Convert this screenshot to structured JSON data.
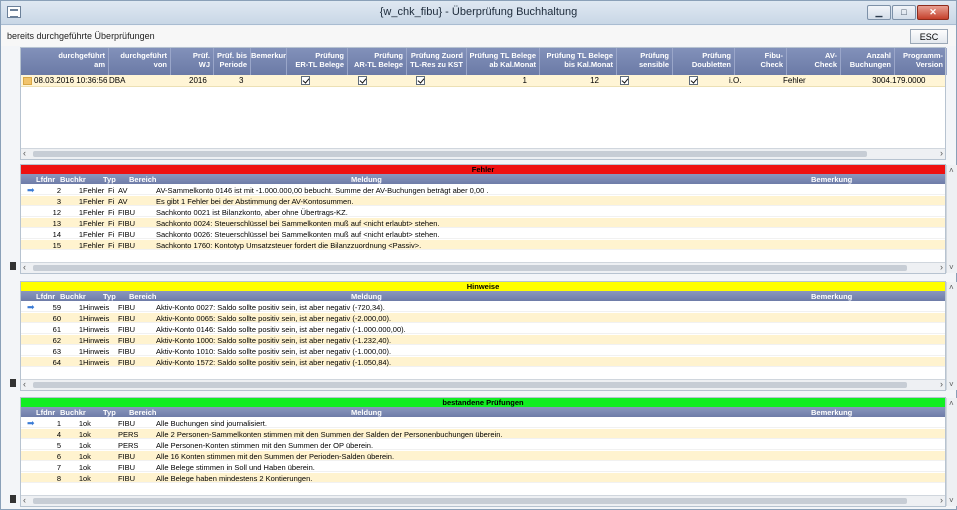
{
  "window": {
    "title": "{w_chk_fibu} - Überprüfung Buchhaltung"
  },
  "controls": {
    "minimize": "▁",
    "maximize": "□",
    "close": "✕",
    "esc": "ESC"
  },
  "subheader": {
    "label": "bereits durchgeführte Überprüfungen"
  },
  "top_grid": {
    "headers": [
      [
        "durchgeführt",
        "am"
      ],
      [
        "durchgeführt",
        "von"
      ],
      [
        "Prüf.",
        "WJ"
      ],
      [
        "Prüf. bis",
        "Periode"
      ],
      [
        "Bemerkung",
        ""
      ],
      [
        "Prüfung",
        "ER-TL Belege"
      ],
      [
        "Prüfung",
        "AR-TL Belege"
      ],
      [
        "Prüfung Zuord",
        "TL-Res zu KST"
      ],
      [
        "Prüfung TL Belege",
        "ab Kal.Monat"
      ],
      [
        "Prüfung TL Belege",
        "bis Kal.Monat"
      ],
      [
        "Prüfung",
        "sensible"
      ],
      [
        "Prüfung",
        "Doubletten"
      ],
      [
        "Fibu-",
        "Check"
      ],
      [
        "AV-",
        "Check"
      ],
      [
        "Anzahl",
        "Buchungen"
      ],
      [
        "Programm-",
        "Version"
      ]
    ],
    "row": {
      "datum": "08.03.2016 10:36:56",
      "von": "DBA",
      "wj": "2016",
      "periode": "3",
      "er_tl": true,
      "ar_tl": true,
      "zuord": true,
      "ab_monat": "1",
      "bis_monat": "12",
      "sensible": true,
      "doubletten": true,
      "fibu_check": "i.O.",
      "av_check": "Fehler",
      "anzahl": "30",
      "version": "04.179.0000"
    }
  },
  "sections": [
    {
      "title": "Fehler",
      "color": "#ee1111",
      "columns": [
        "Lfdnr",
        "Buchkr",
        "Typ",
        "Bereich",
        "Meldung",
        "Bemerkung"
      ],
      "rows": [
        [
          "2",
          "1",
          "Fehler",
          "Fi",
          "AV",
          "AV-Sammelkonto 0146 ist mit -1.000.000,00 bebucht. Summe der AV-Buchungen beträgt aber 0,00 ."
        ],
        [
          "3",
          "1",
          "Fehler",
          "Fi",
          "AV",
          "Es gibt 1 Fehler bei der Abstimmung der AV-Kontosummen."
        ],
        [
          "12",
          "1",
          "Fehler",
          "Fi",
          "FIBU",
          "Sachkonto 0021 ist Bilanzkonto, aber ohne Übertrags-KZ."
        ],
        [
          "13",
          "1",
          "Fehler",
          "Fi",
          "FIBU",
          "Sachkonto 0024: Steuerschlüssel bei Sammelkonten muß auf <nicht erlaubt> stehen."
        ],
        [
          "14",
          "1",
          "Fehler",
          "Fi",
          "FIBU",
          "Sachkonto 0026: Steuerschlüssel bei Sammelkonten muß auf <nicht erlaubt> stehen."
        ],
        [
          "15",
          "1",
          "Fehler",
          "Fi",
          "FIBU",
          "Sachkonto 1760: Kontotyp Umsatzsteuer fordert die Bilanzzuordnung <Passiv>."
        ]
      ]
    },
    {
      "title": "Hinweise",
      "color": "#ffff00",
      "columns": [
        "Lfdnr",
        "Buchkr",
        "Typ",
        "Bereich",
        "Meldung",
        "Bemerkung"
      ],
      "rows": [
        [
          "59",
          "1",
          "Hinweis",
          "",
          "FIBU",
          "Aktiv-Konto 0027: Saldo sollte positiv sein, ist aber negativ (-720,34)."
        ],
        [
          "60",
          "1",
          "Hinweis",
          "",
          "FIBU",
          "Aktiv-Konto 0065: Saldo sollte positiv sein, ist aber negativ (-2.000,00)."
        ],
        [
          "61",
          "1",
          "Hinweis",
          "",
          "FIBU",
          "Aktiv-Konto 0146: Saldo sollte positiv sein, ist aber negativ (-1.000.000,00)."
        ],
        [
          "62",
          "1",
          "Hinweis",
          "",
          "FIBU",
          "Aktiv-Konto 1000: Saldo sollte positiv sein, ist aber negativ (-1.232,40)."
        ],
        [
          "63",
          "1",
          "Hinweis",
          "",
          "FIBU",
          "Aktiv-Konto 1010: Saldo sollte positiv sein, ist aber negativ (-1.000,00)."
        ],
        [
          "64",
          "1",
          "Hinweis",
          "",
          "FIBU",
          "Aktiv-Konto 1572: Saldo sollte positiv sein, ist aber negativ (-1.050,84)."
        ]
      ]
    },
    {
      "title": "bestandene Prüfungen",
      "color": "#11ee22",
      "columns": [
        "Lfdnr",
        "Buchkr",
        "Typ",
        "Bereich",
        "Meldung",
        "Bemerkung"
      ],
      "rows": [
        [
          "1",
          "1",
          "ok",
          "",
          "FIBU",
          "Alle Buchungen sind journalisiert."
        ],
        [
          "4",
          "1",
          "ok",
          "",
          "PERS",
          "Alle 2 Personen-Sammelkonten stimmen mit den Summen der Salden der Personenbuchungen überein."
        ],
        [
          "5",
          "1",
          "ok",
          "",
          "PERS",
          "Alle Personen-Konten stimmen mit den Summen der OP überein."
        ],
        [
          "6",
          "1",
          "ok",
          "",
          "FIBU",
          "Alle 16 Konten stimmen mit den Summen der Perioden-Salden überein."
        ],
        [
          "7",
          "1",
          "ok",
          "",
          "FIBU",
          "Alle Belege stimmen in Soll und Haben überein."
        ],
        [
          "8",
          "1",
          "ok",
          "",
          "FIBU",
          "Alle Belege haben mindestens 2 Kontierungen."
        ]
      ]
    }
  ]
}
